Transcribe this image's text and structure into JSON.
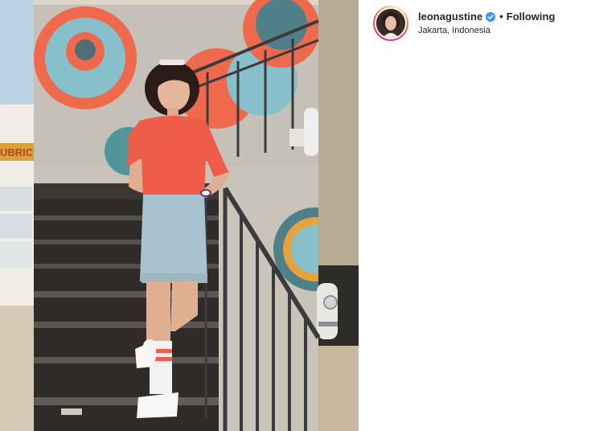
{
  "post": {
    "header": {
      "username": "leonagustine",
      "verified": true,
      "separator": "•",
      "follow_status": "Following",
      "location": "Jakarta, Indonesia"
    },
    "photo": {
      "storefront_sign": "UBRIC",
      "colors": {
        "accent_red": "#ef6a4d",
        "mural_blue": "#87c0cb",
        "teal": "#4f9599",
        "verified_blue": "#3897f0"
      }
    }
  }
}
